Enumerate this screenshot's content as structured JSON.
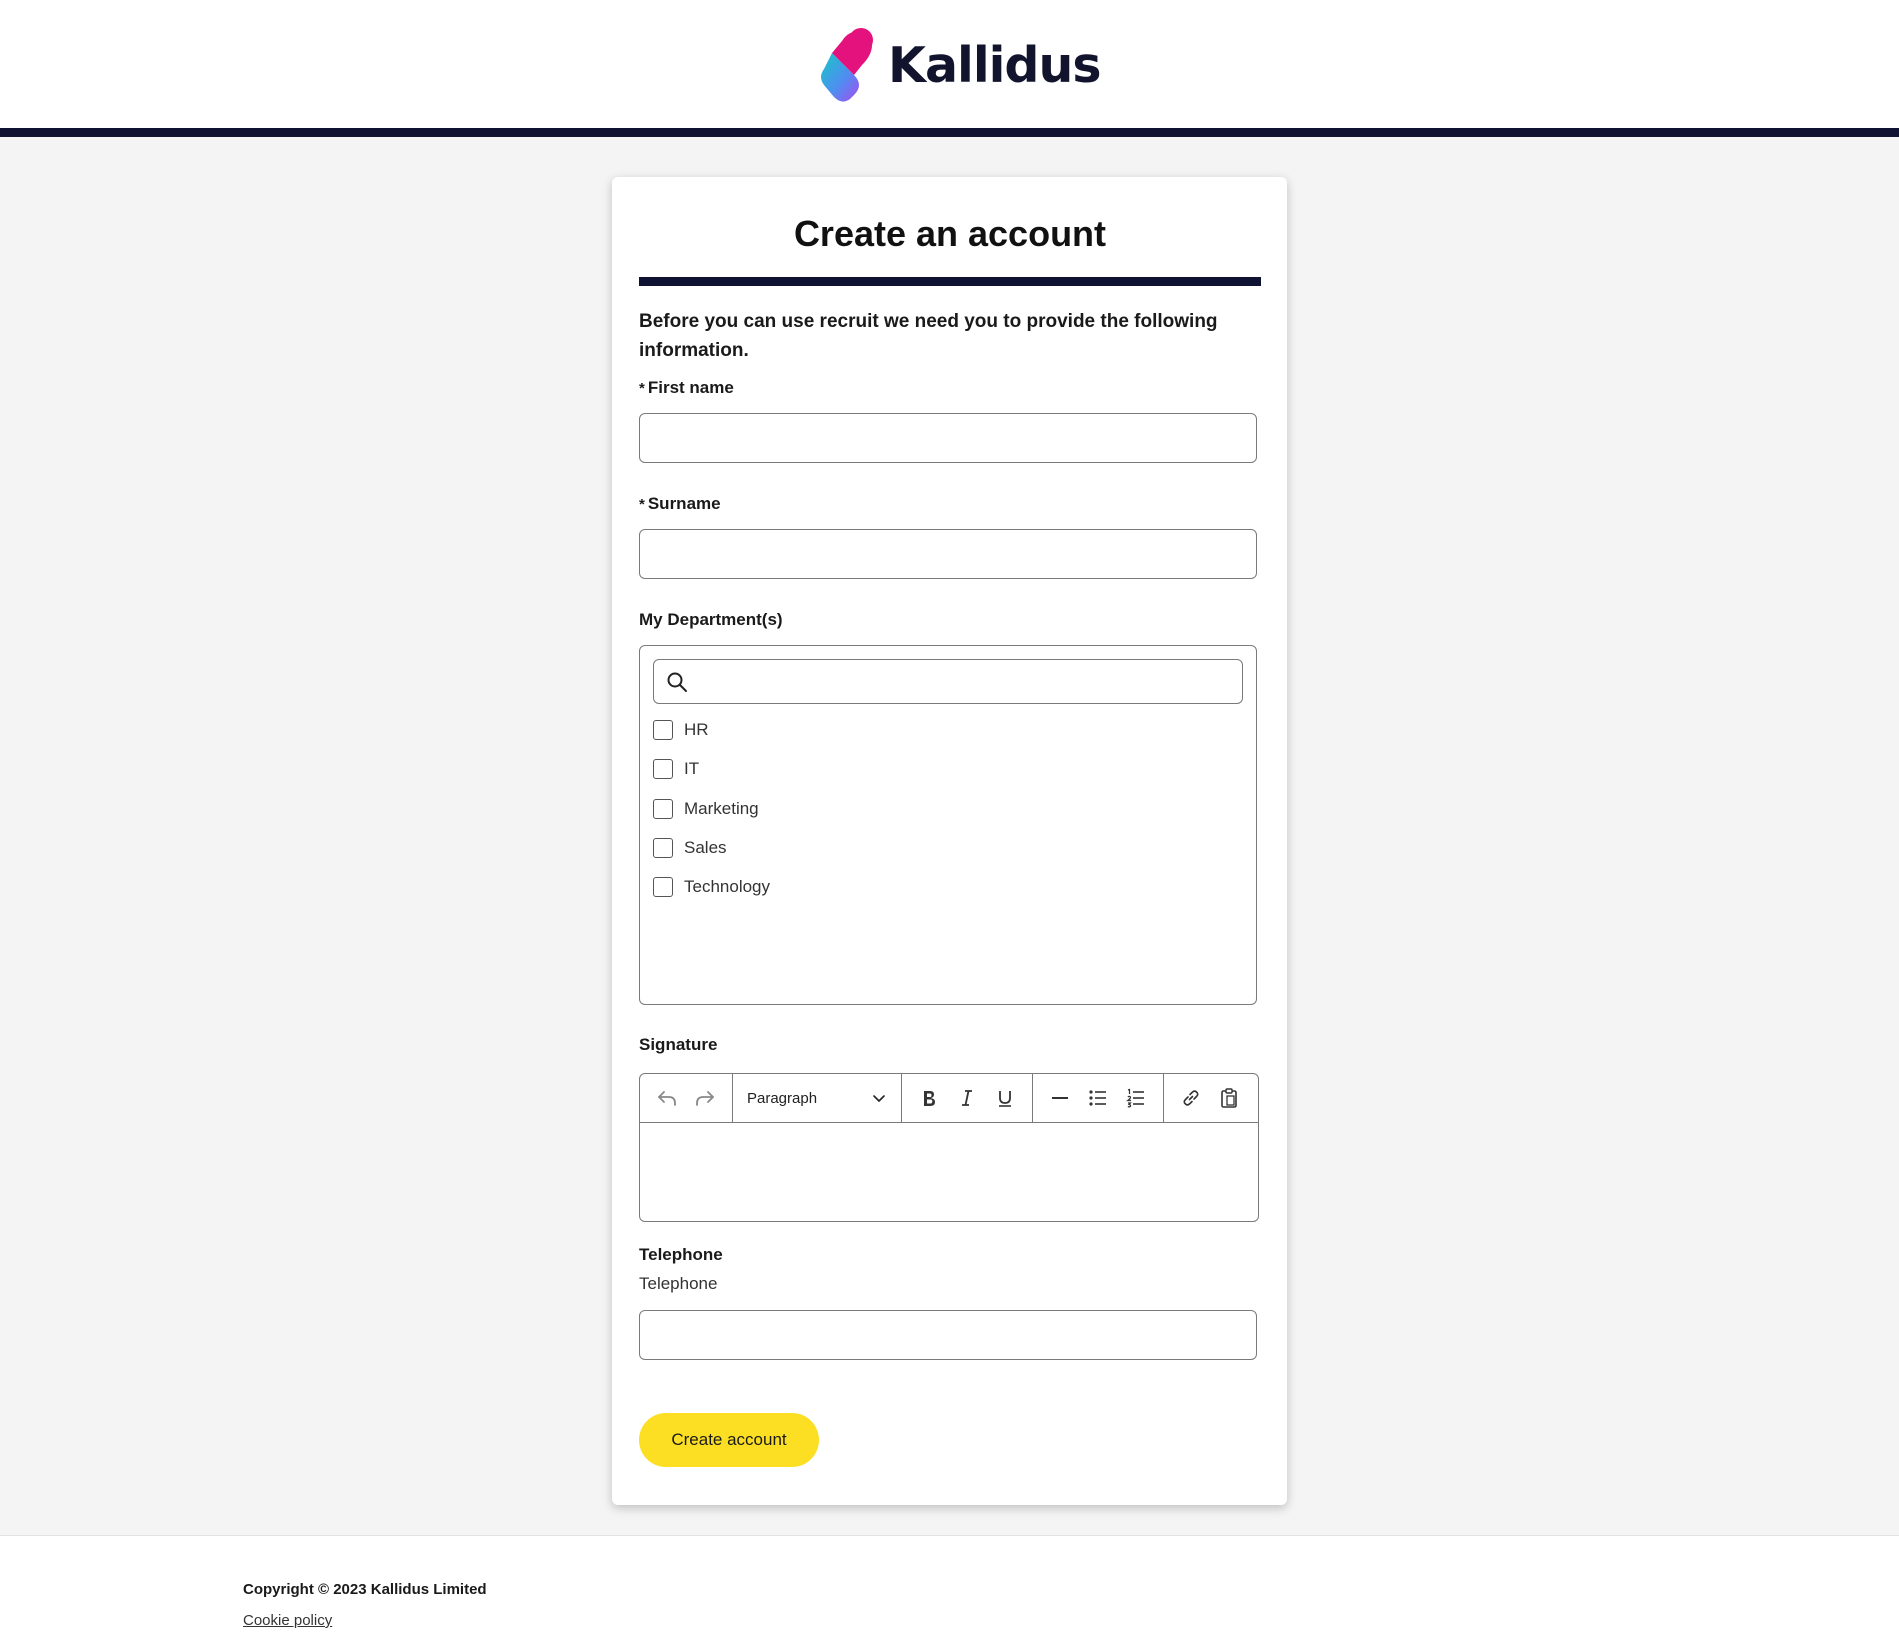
{
  "brand": {
    "name": "Kallidus",
    "colors": {
      "navy": "#0f1232",
      "accent_yellow": "#fcdf23",
      "logo_pink": "#e6107d",
      "logo_teal": "#1fc3c9",
      "logo_purple": "#8d4cf0"
    }
  },
  "form": {
    "title": "Create an account",
    "intro": "Before you can use recruit we need you to provide the following information.",
    "required_marker": "*",
    "first_name": {
      "label": "First name",
      "value": ""
    },
    "surname": {
      "label": "Surname",
      "value": ""
    },
    "departments": {
      "label": "My Department(s)",
      "search_value": "",
      "search_icon": "search-icon",
      "options": [
        {
          "label": "HR",
          "checked": false
        },
        {
          "label": "IT",
          "checked": false
        },
        {
          "label": "Marketing",
          "checked": false
        },
        {
          "label": "Sales",
          "checked": false
        },
        {
          "label": "Technology",
          "checked": false
        }
      ]
    },
    "signature": {
      "label": "Signature",
      "block_format": "Paragraph",
      "toolbar_icons": [
        "undo-icon",
        "redo-icon",
        "chevron-down-icon",
        "bold-icon",
        "italic-icon",
        "underline-icon",
        "horizontal-rule-icon",
        "bullet-list-icon",
        "numbered-list-icon",
        "link-icon",
        "paste-icon"
      ],
      "content": ""
    },
    "telephone": {
      "label": "Telephone",
      "hint": "Telephone",
      "value": ""
    },
    "submit_label": "Create account"
  },
  "footer": {
    "copyright": "Copyright © 2023 Kallidus Limited",
    "cookie_link": "Cookie policy"
  }
}
